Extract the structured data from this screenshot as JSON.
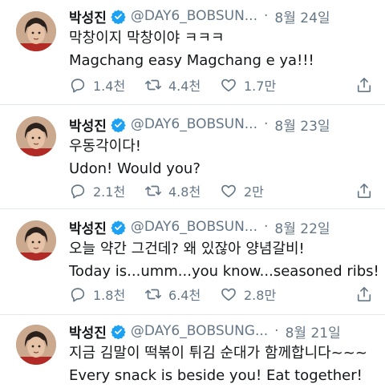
{
  "tweets": [
    {
      "name": "박성진",
      "handle": "@DAY6_BOBSUN...",
      "dot": "·",
      "date": "8월 24일",
      "line1": "막창이지 막창이야 ㅋㅋㅋ",
      "line2": "Magchang easy Magchang e ya!!!",
      "replies": "1.4천",
      "retweets": "4.4천",
      "likes": "1.7만"
    },
    {
      "name": "박성진",
      "handle": "@DAY6_BOBSUN...",
      "dot": "·",
      "date": "8월 23일",
      "line1": "우동각이다!",
      "line2": "Udon! Would you?",
      "replies": "2.1천",
      "retweets": "4.8천",
      "likes": "2만"
    },
    {
      "name": "박성진",
      "handle": "@DAY6_BOBSUN...",
      "dot": "·",
      "date": "8월 22일",
      "line1": "오늘 약간 그건데? 왜 있잖아 양념갈비!",
      "line2": "Today is...umm...you know...seasoned ribs!",
      "replies": "1.8천",
      "retweets": "6.4천",
      "likes": "2.8만"
    },
    {
      "name": "박성진",
      "handle": "@DAY6_BOBSUNG...",
      "dot": "·",
      "date": "8월 21일",
      "line1": "지금 김말이 떡볶이 튀김 순대가 함께합니다~~~",
      "line2": "Every snack is beside you! Eat together!"
    }
  ],
  "colors": {
    "muted": "#657786",
    "verified": "#1da1f2",
    "divider": "#e1e8ed"
  },
  "icons": [
    "verified-badge-icon",
    "reply-icon",
    "retweet-icon",
    "like-icon",
    "share-icon"
  ]
}
